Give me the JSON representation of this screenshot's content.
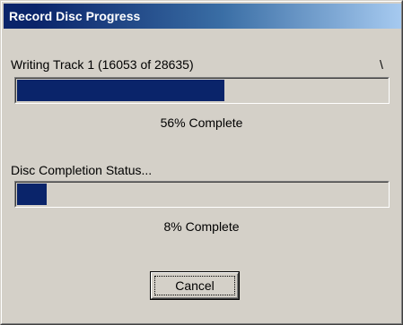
{
  "window": {
    "title": "Record Disc Progress"
  },
  "track": {
    "status_text": "Writing Track 1 (16053 of 28635)",
    "spinner": "\\",
    "progress_fraction": 0.56,
    "percent_text": "56% Complete"
  },
  "disc": {
    "status_text": "Disc Completion Status...",
    "progress_fraction": 0.08,
    "percent_text": "8% Complete"
  },
  "buttons": {
    "cancel_label": "Cancel"
  },
  "colors": {
    "face": "#d4d0c8",
    "title_start": "#0a246a",
    "title_end": "#a6caf0",
    "progress_fill": "#0a246a"
  }
}
